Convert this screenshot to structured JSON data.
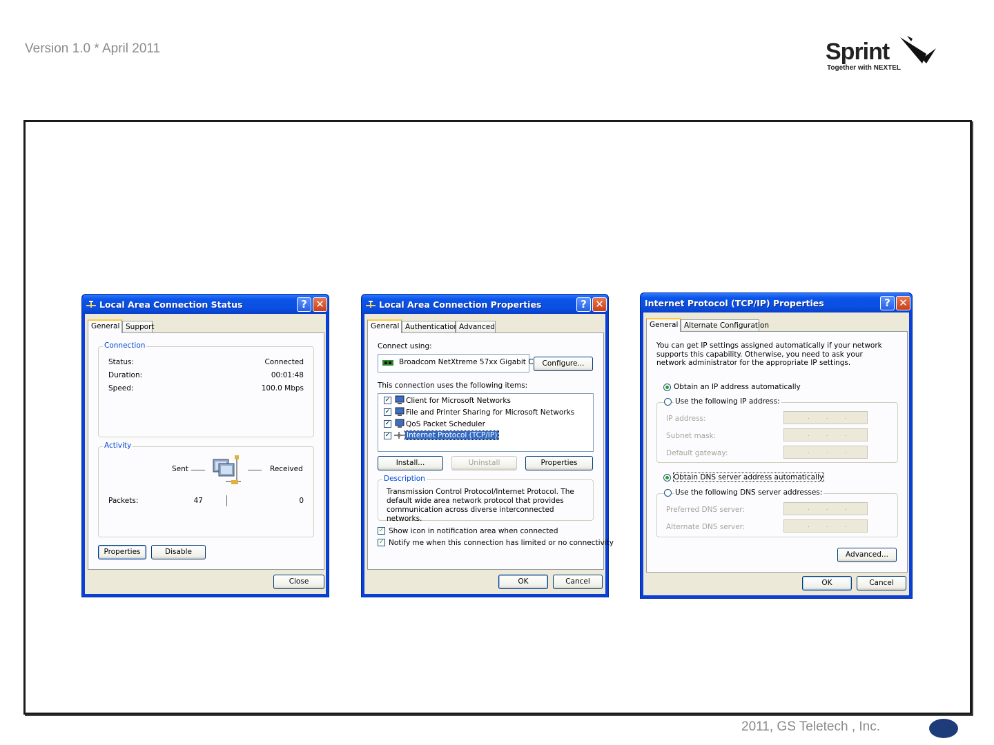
{
  "header": {
    "version": "Version 1.0 * April 2011"
  },
  "logo": {
    "brand": "Sprint",
    "tagline": "Together with NEXTEL"
  },
  "footer": {
    "copyright": "2011, GS Teletech , Inc."
  },
  "win1": {
    "title": "Local Area Connection Status",
    "tabs": [
      "General",
      "Support"
    ],
    "connection": {
      "label": "Connection",
      "status_label": "Status:",
      "status_value": "Connected",
      "duration_label": "Duration:",
      "duration_value": "00:01:48",
      "speed_label": "Speed:",
      "speed_value": "100.0 Mbps"
    },
    "activity": {
      "label": "Activity",
      "sent": "Sent",
      "received": "Received",
      "packets_label": "Packets:",
      "packets_sent": "47",
      "packets_received": "0"
    },
    "buttons": {
      "properties": "Properties",
      "disable": "Disable",
      "close": "Close"
    }
  },
  "win2": {
    "title": "Local Area Connection Properties",
    "tabs": [
      "General",
      "Authentication",
      "Advanced"
    ],
    "connect_using": "Connect using:",
    "adapter": "Broadcom NetXtreme 57xx Gigabit C",
    "configure": "Configure...",
    "items_label": "This connection uses the following items:",
    "items": [
      "Client for Microsoft Networks",
      "File and Printer Sharing for Microsoft Networks",
      "QoS Packet Scheduler",
      "Internet Protocol (TCP/IP)"
    ],
    "install": "Install...",
    "uninstall": "Uninstall",
    "properties": "Properties",
    "description_label": "Description",
    "description": "Transmission Control Protocol/Internet Protocol. The default wide area network protocol that provides communication across diverse interconnected networks.",
    "show_icon": "Show icon in notification area when connected",
    "notify": "Notify me when this connection has limited or no connectivity",
    "ok": "OK",
    "cancel": "Cancel"
  },
  "win3": {
    "title": "Internet Protocol (TCP/IP) Properties",
    "tabs": [
      "General",
      "Alternate Configuration"
    ],
    "intro": "You can get IP settings assigned automatically if your network supports this capability. Otherwise, you need to ask your network administrator for the appropriate IP settings.",
    "obtain_ip": "Obtain an IP address automatically",
    "use_ip": "Use the following IP address:",
    "ip_address": "IP address:",
    "subnet_mask": "Subnet mask:",
    "default_gateway": "Default gateway:",
    "obtain_dns": "Obtain DNS server address automatically",
    "use_dns": "Use the following DNS server addresses:",
    "preferred_dns": "Preferred DNS server:",
    "alternate_dns": "Alternate DNS server:",
    "ip_placeholder": "...",
    "advanced": "Advanced...",
    "ok": "OK",
    "cancel": "Cancel"
  }
}
